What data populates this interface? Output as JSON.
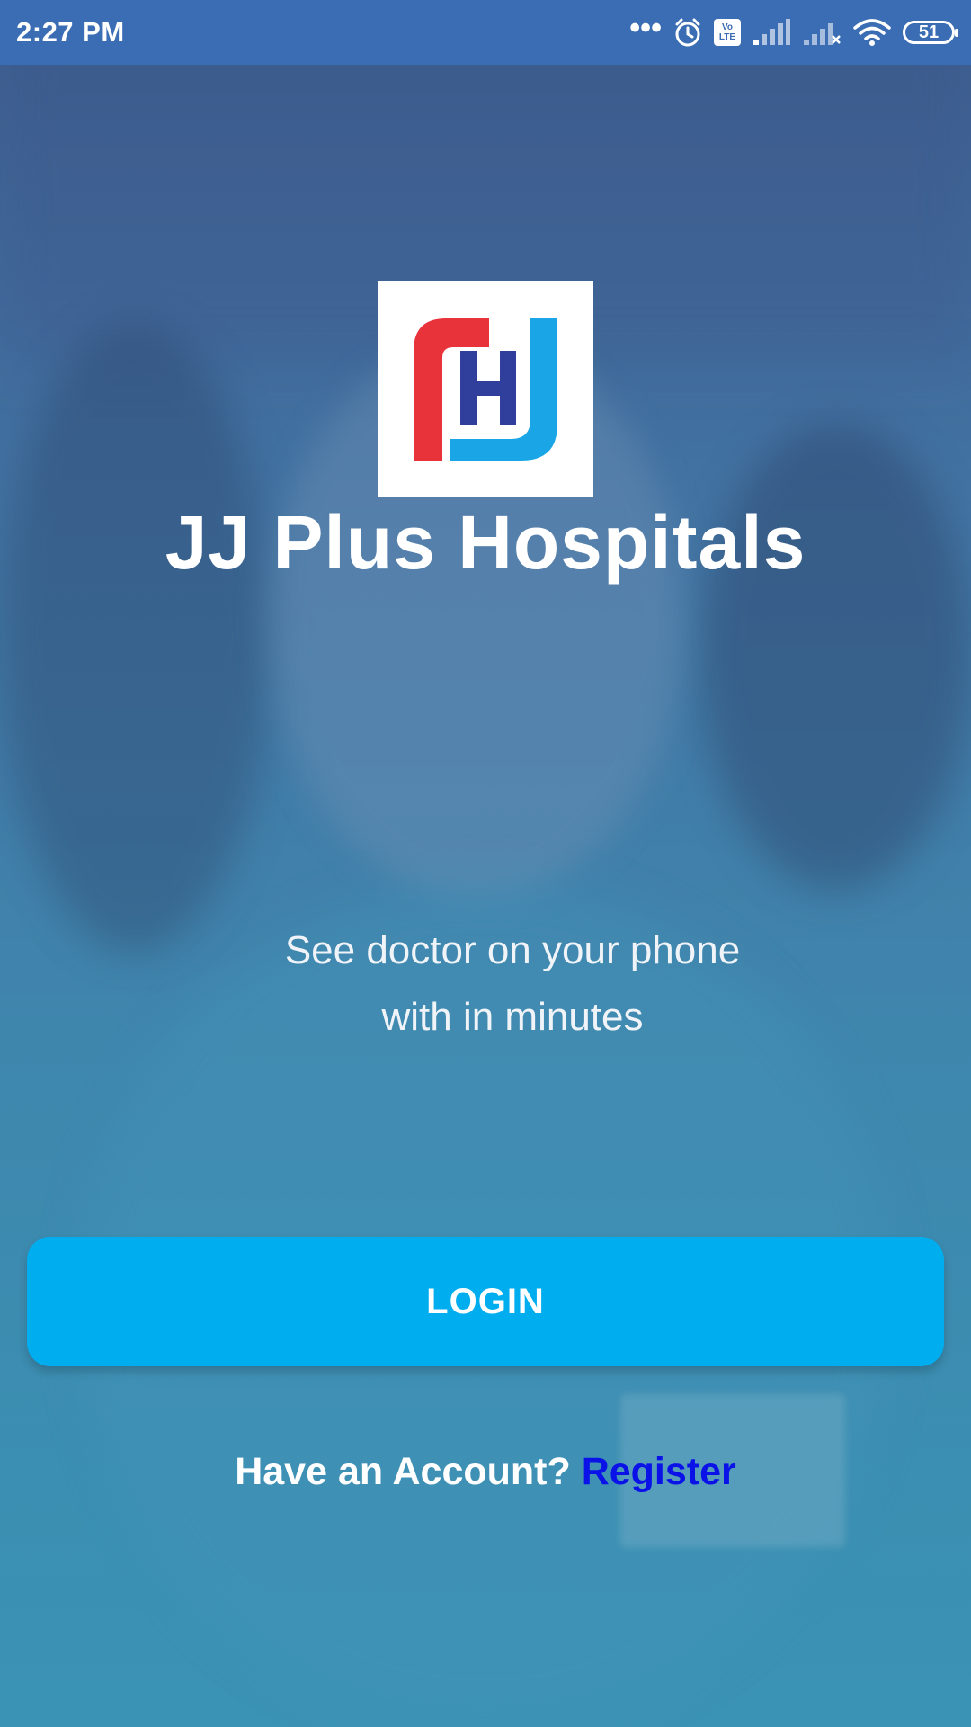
{
  "status_bar": {
    "time": "2:27 PM",
    "more": "•••",
    "volte_top": "Vo",
    "volte_bottom": "LTE",
    "battery": "51",
    "icons": [
      "more-dots-icon",
      "alarm-icon",
      "volte-icon",
      "signal-icon",
      "signal-no-service-icon",
      "wifi-icon",
      "battery-icon"
    ]
  },
  "app": {
    "logo_icon": "jj-plus-hospitals-logo",
    "title": "JJ Plus Hospitals",
    "tagline_line1": "See doctor on your phone",
    "tagline_line2": "with in minutes"
  },
  "actions": {
    "login_label": "LOGIN",
    "account_prompt": "Have an Account?",
    "register_label": "Register"
  },
  "colors": {
    "status_bar": "#3a6db3",
    "login_button": "#00aeef",
    "register_link": "#0a12e8",
    "logo_red": "#e8333a",
    "logo_blue": "#1aa6e6",
    "logo_navy": "#2f3f9b"
  }
}
